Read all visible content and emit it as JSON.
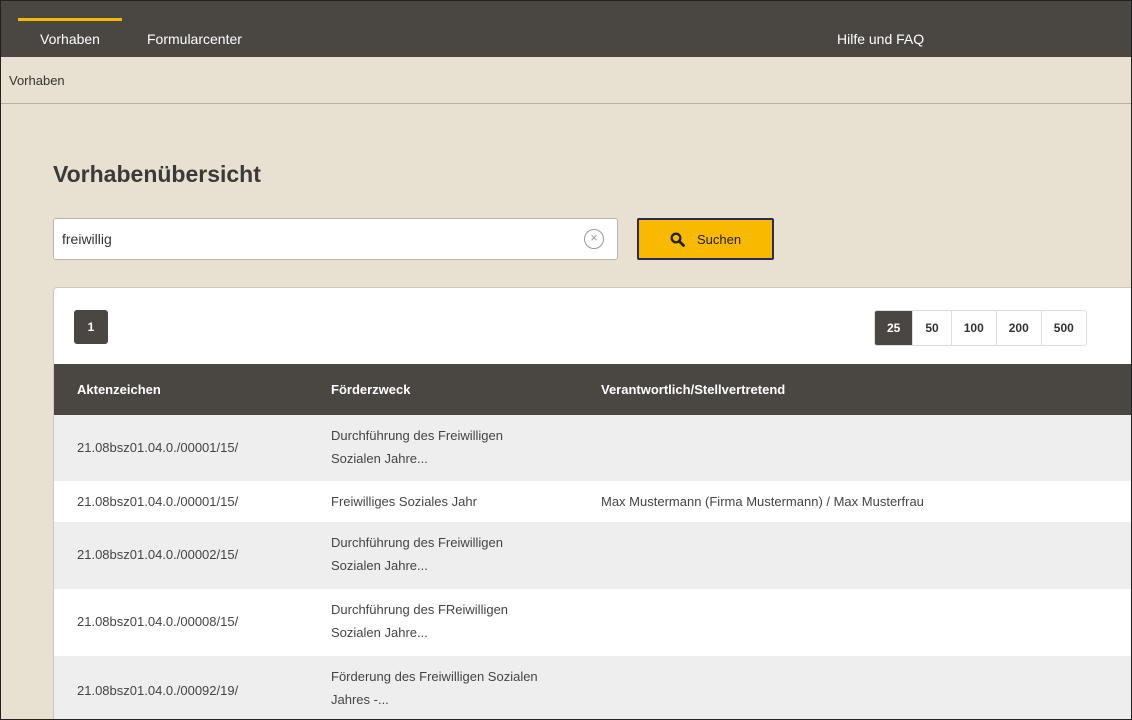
{
  "nav": {
    "tabs": [
      {
        "label": "Vorhaben"
      },
      {
        "label": "Formularcenter"
      },
      {
        "label": "Hilfe und FAQ"
      }
    ]
  },
  "breadcrumb": "Vorhaben",
  "page_title": "Vorhabenübersicht",
  "search": {
    "value": "freiwillig",
    "placeholder": "",
    "clear_icon": "×",
    "button_label": "Suchen"
  },
  "pagination": {
    "current_page": "1",
    "page_sizes": [
      "25",
      "50",
      "100",
      "200",
      "500"
    ],
    "selected_size": "25"
  },
  "table": {
    "columns": [
      "Aktenzeichen",
      "Förderzweck",
      "Verantwortlich/Stellvertretend"
    ],
    "rows": [
      {
        "aktenzeichen": "21.08bsz01.04.0./00001/15/",
        "zweck_1": "Durchführung des Freiwilligen",
        "zweck_2": "Sozialen Jahre...",
        "verantwortlich": ""
      },
      {
        "aktenzeichen": "21.08bsz01.04.0./00001/15/",
        "zweck_1": "Freiwilliges Soziales Jahr",
        "zweck_2": "",
        "verantwortlich": "Max Mustermann (Firma Mustermann) / Max Musterfrau"
      },
      {
        "aktenzeichen": "21.08bsz01.04.0./00002/15/",
        "zweck_1": "Durchführung des Freiwilligen",
        "zweck_2": "Sozialen Jahre...",
        "verantwortlich": ""
      },
      {
        "aktenzeichen": "21.08bsz01.04.0./00008/15/",
        "zweck_1": "Durchführung des FReiwilligen",
        "zweck_2": "Sozialen Jahre...",
        "verantwortlich": ""
      },
      {
        "aktenzeichen": "21.08bsz01.04.0./00092/19/",
        "zweck_1": "Förderung des Freiwilligen Sozialen",
        "zweck_2": "Jahres -...",
        "verantwortlich": ""
      }
    ]
  },
  "colors": {
    "nav_bg": "#4a4642",
    "accent": "#f8b900",
    "page_bg": "#e8e0d0"
  }
}
